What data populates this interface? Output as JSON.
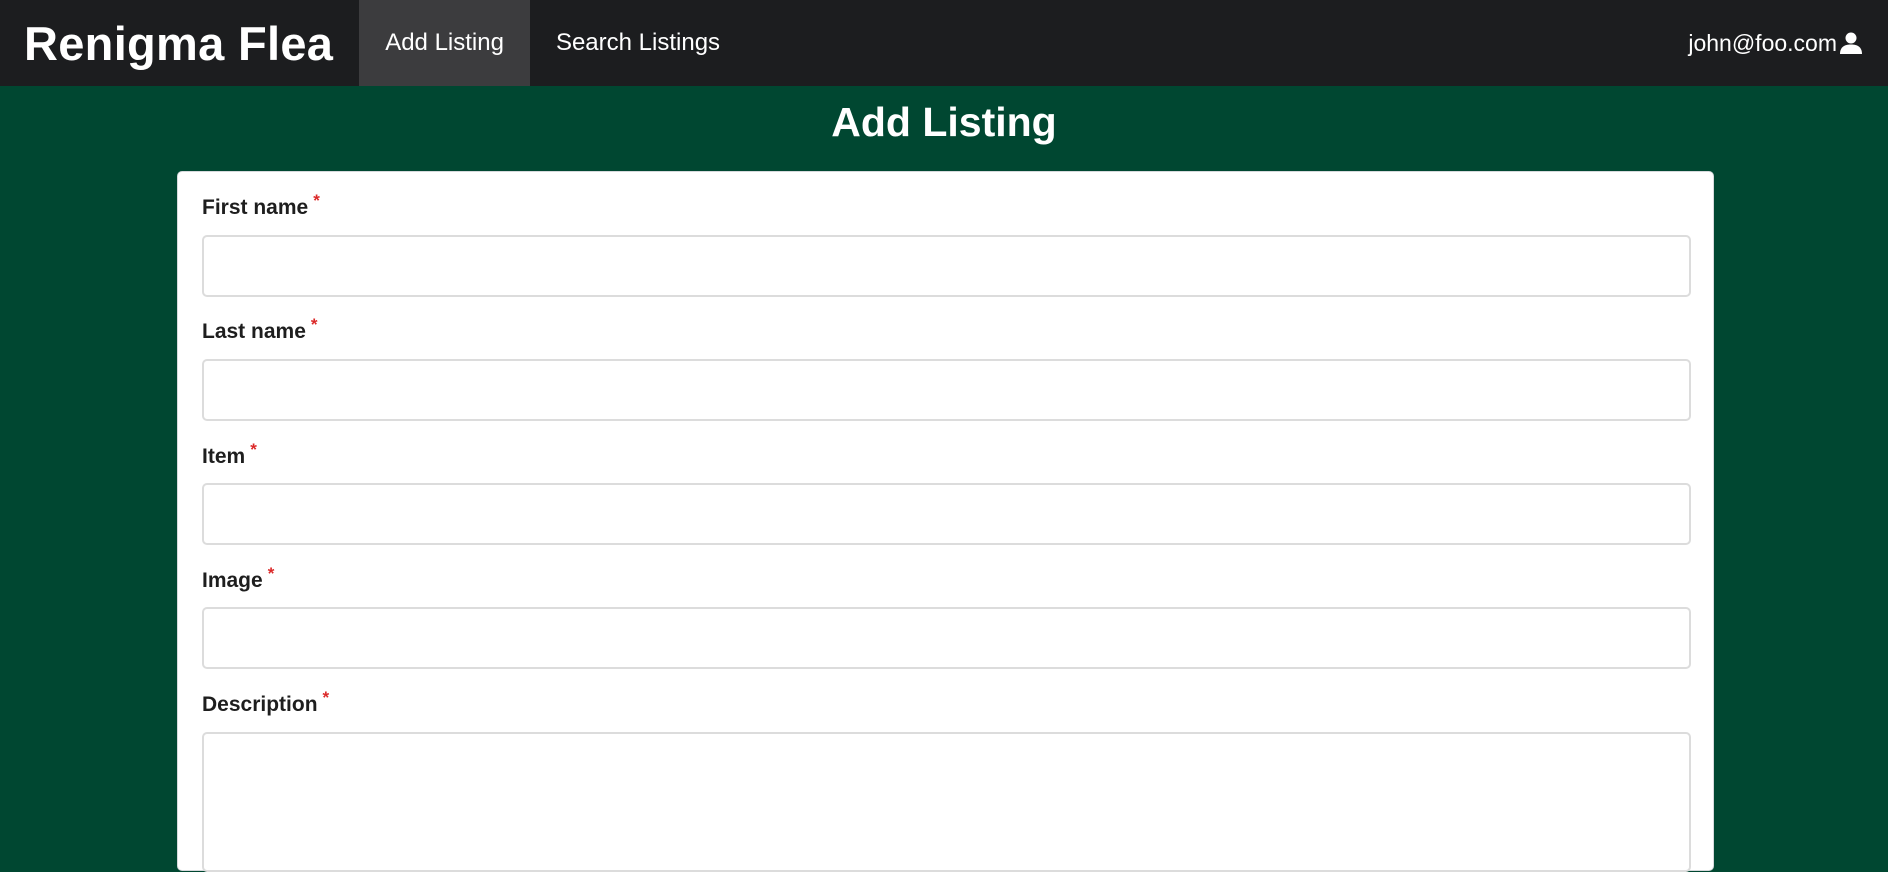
{
  "app": {
    "brand": "Renigma Flea",
    "nav_tabs": [
      {
        "label": "Add Listing",
        "active": true
      },
      {
        "label": "Search Listings",
        "active": false
      }
    ],
    "user": {
      "email": "john@foo.com",
      "icon": "user-icon"
    }
  },
  "page": {
    "title": "Add Listing"
  },
  "form": {
    "required_marker": "*",
    "fields": [
      {
        "label": "First name",
        "value": "",
        "placeholder": ""
      },
      {
        "label": "Last name",
        "value": "",
        "placeholder": ""
      },
      {
        "label": "Item",
        "value": "",
        "placeholder": ""
      },
      {
        "label": "Image",
        "value": "",
        "placeholder": ""
      },
      {
        "label": "Description",
        "value": "",
        "placeholder": ""
      }
    ]
  },
  "colors": {
    "navbar_bg": "#1c1d1f",
    "active_tab_bg": "#3c3c3e",
    "page_bg": "#004731",
    "required_marker": "#db2828"
  }
}
